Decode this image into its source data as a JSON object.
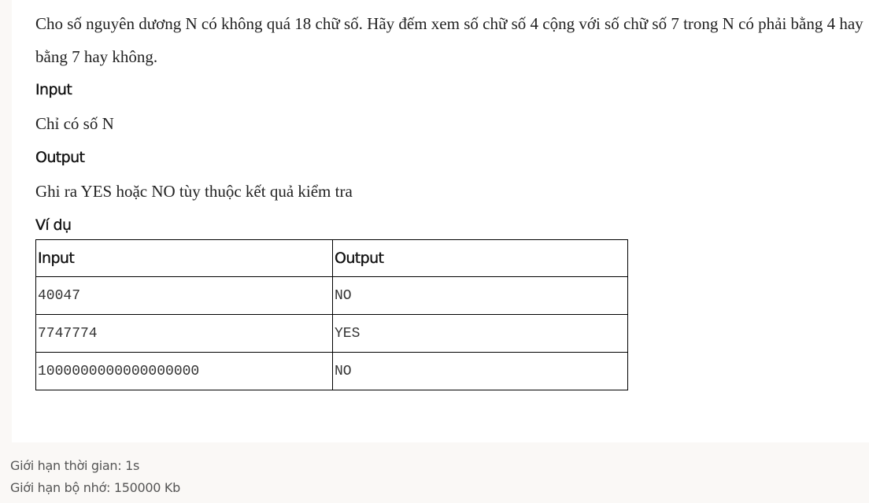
{
  "problem": {
    "statement": "Cho số nguyên dương N có không quá 18 chữ số. Hãy đếm xem số chữ số 4 cộng với số chữ số 7 trong N có phải bằng 4 hay bằng 7 hay không.",
    "input_heading": "Input",
    "input_text": "Chỉ có số N",
    "output_heading": "Output",
    "output_text": "Ghi ra YES hoặc NO tùy thuộc kết quả kiểm tra",
    "example_heading": "Ví dụ"
  },
  "example_table": {
    "headers": [
      "Input",
      "Output"
    ],
    "rows": [
      {
        "input": "40047",
        "output": "NO"
      },
      {
        "input": "7747774",
        "output": "YES"
      },
      {
        "input": "1000000000000000000",
        "output": "NO"
      }
    ]
  },
  "limits": {
    "time": "Giới hạn thời gian: 1s",
    "memory": "Giới hạn bộ nhớ: 150000 Kb"
  }
}
